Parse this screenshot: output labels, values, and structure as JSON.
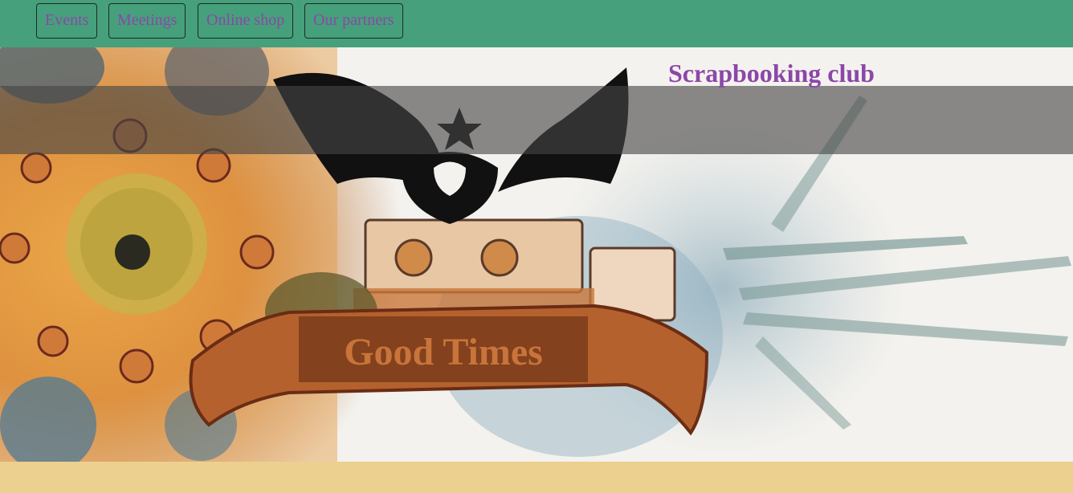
{
  "nav": {
    "items": [
      {
        "label": "Events"
      },
      {
        "label": "Meetings"
      },
      {
        "label": "Online shop"
      },
      {
        "label": "Our partners"
      }
    ]
  },
  "hero": {
    "title": "Scrapbooking club",
    "artwork_text": "Good Times"
  },
  "colors": {
    "nav_background": "#46a07b",
    "link_text": "#8b47a8",
    "page_background": "#ecd08f",
    "title_band": "rgba(70,70,70,0.62)"
  }
}
